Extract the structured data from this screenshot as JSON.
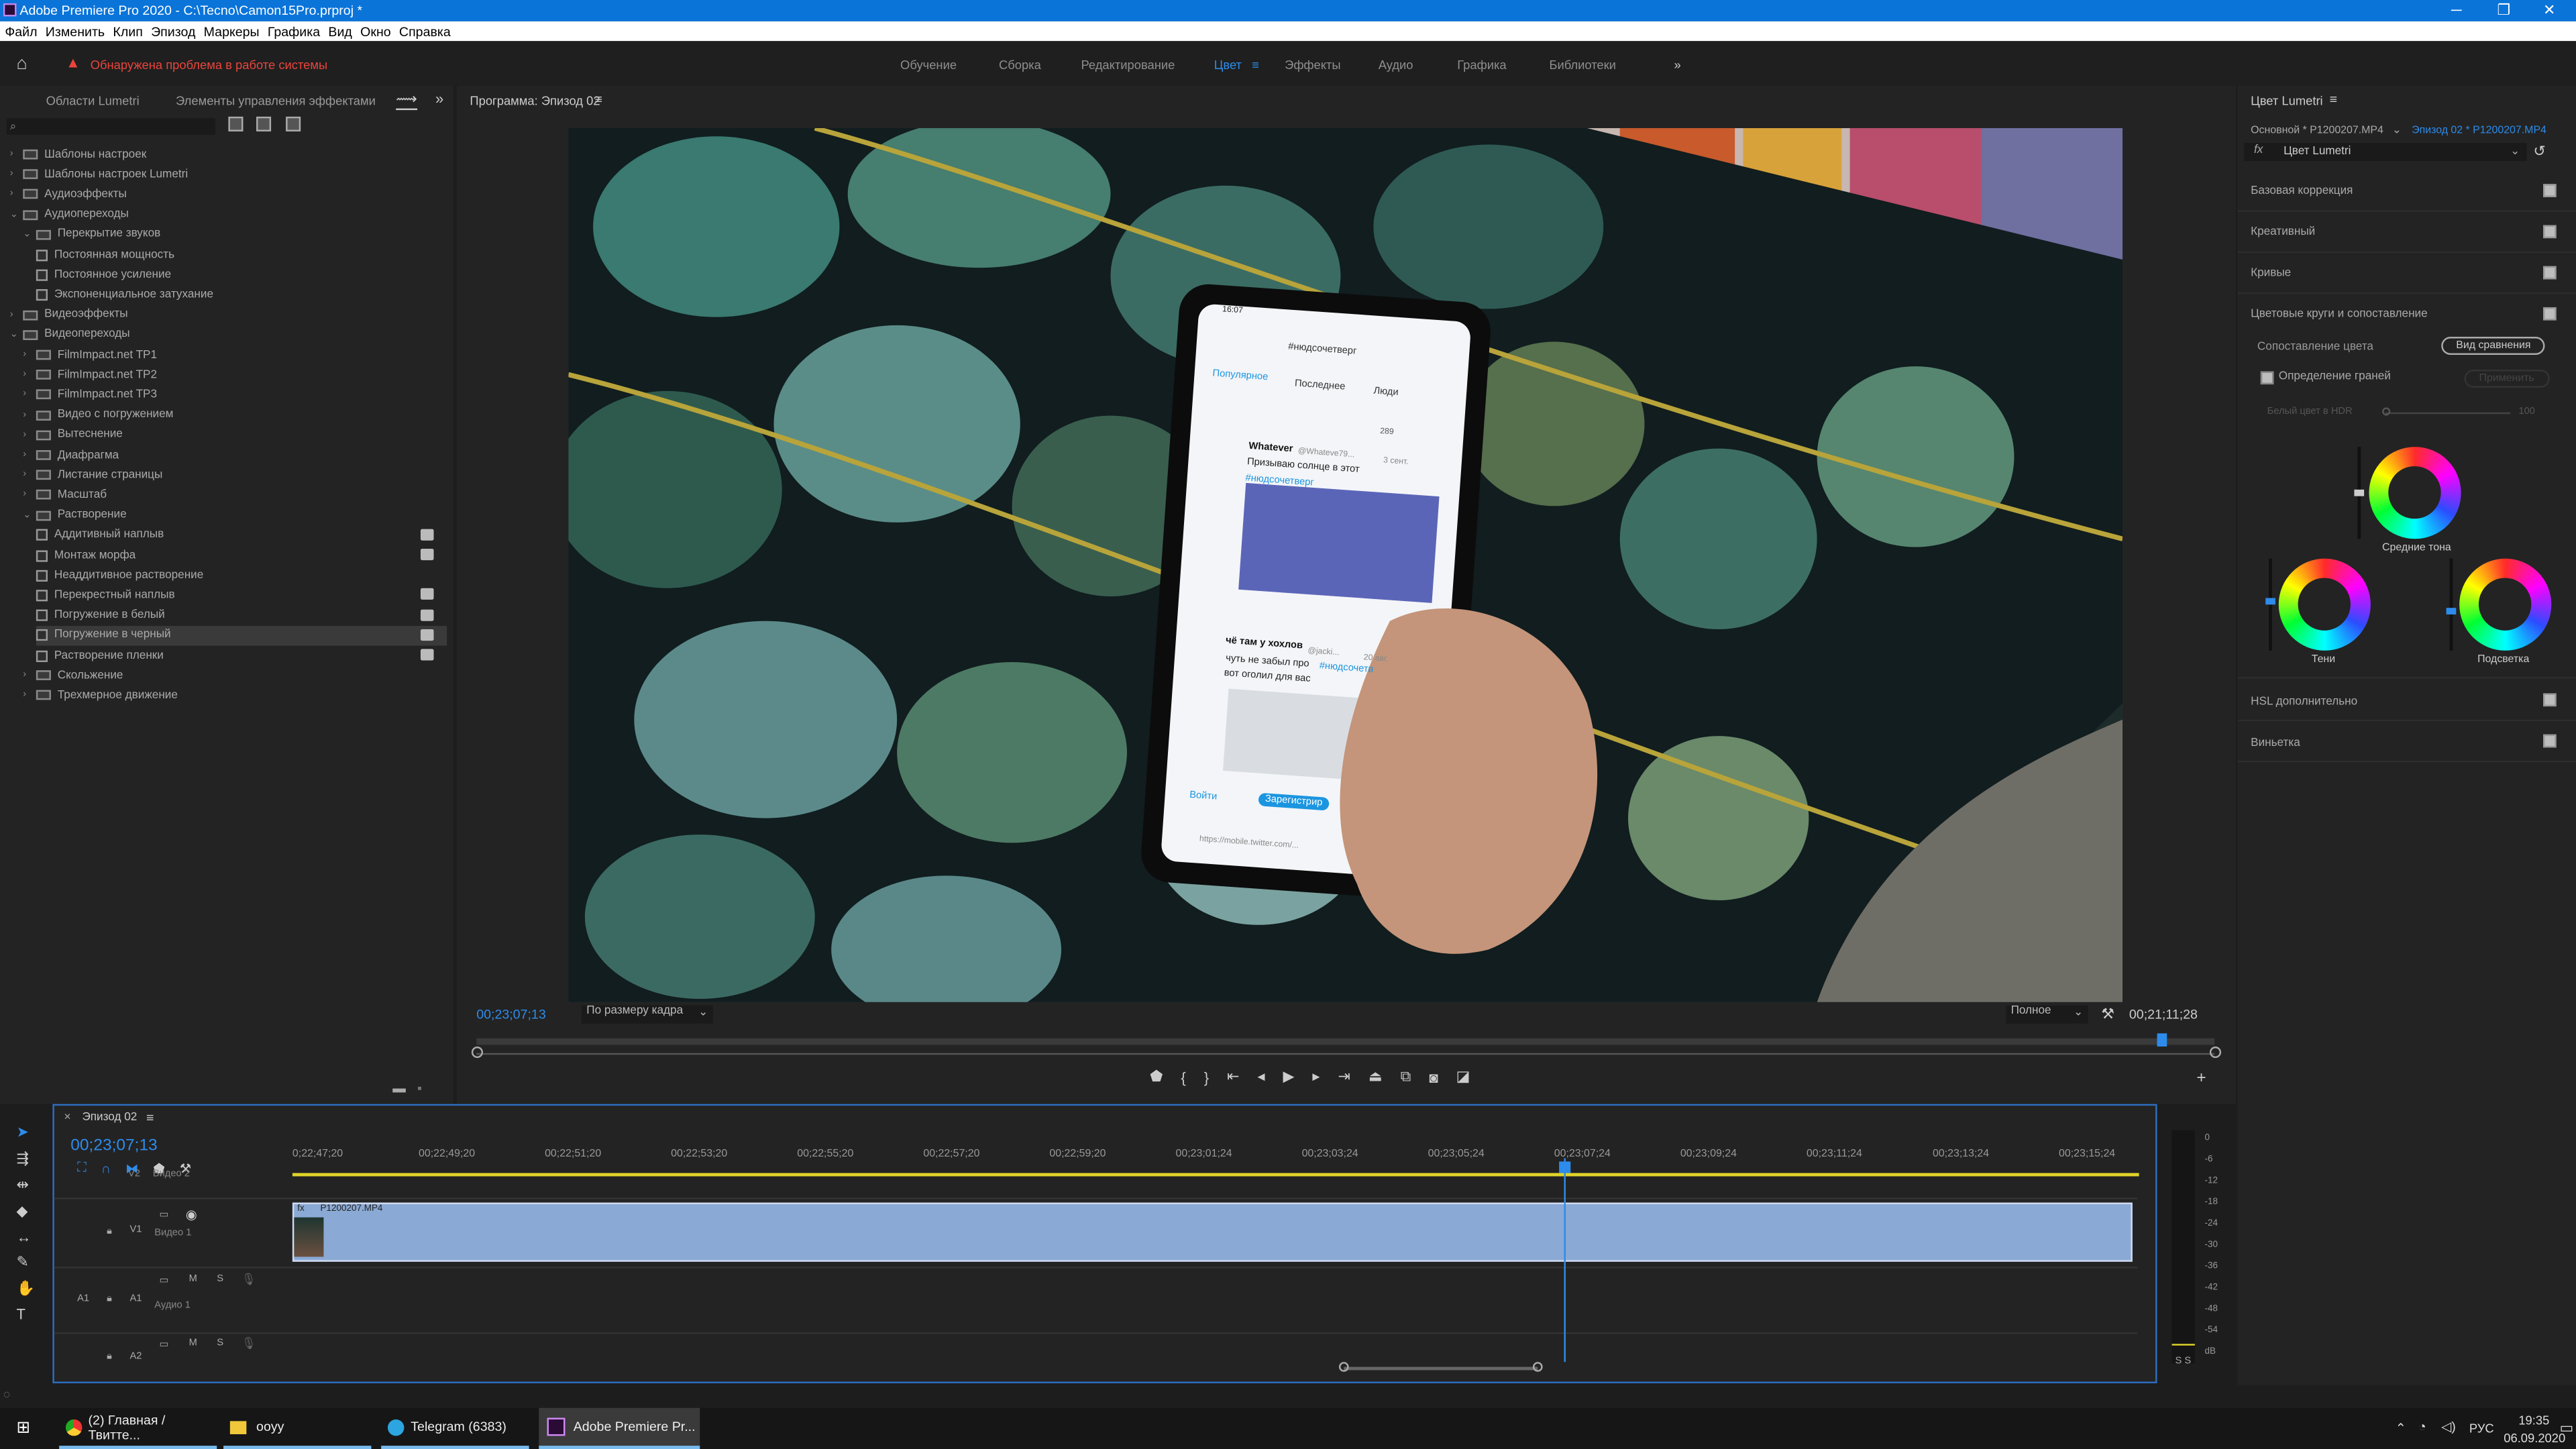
{
  "titlebar": {
    "title": "Adobe Premiere Pro 2020 - C:\\Tecno\\Camon15Pro.prproj *",
    "min": "─",
    "max": "❐",
    "close": "✕"
  },
  "menu": [
    "Файл",
    "Изменить",
    "Клип",
    "Эпизод",
    "Маркеры",
    "Графика",
    "Вид",
    "Окно",
    "Справка"
  ],
  "header": {
    "warning": "Обнаружена проблема в работе системы",
    "workspaces": [
      "Обучение",
      "Сборка",
      "Редактирование",
      "Цвет",
      "Эффекты",
      "Аудио",
      "Графика",
      "Библиотеки"
    ],
    "active_workspace": "Цвет",
    "more": "»"
  },
  "left_panel": {
    "tabs": [
      "Области Lumetri",
      "Элементы управления эффектами"
    ],
    "more": "»",
    "tree": [
      {
        "label": "Шаблоны настроек",
        "indent": 0,
        "kind": "folder",
        "open": false
      },
      {
        "label": "Шаблоны настроек Lumetri",
        "indent": 0,
        "kind": "folder",
        "open": false
      },
      {
        "label": "Аудиоэффекты",
        "indent": 0,
        "kind": "folder",
        "open": false
      },
      {
        "label": "Аудиопереходы",
        "indent": 0,
        "kind": "folder",
        "open": true
      },
      {
        "label": "Перекрытие звуков",
        "indent": 1,
        "kind": "folder",
        "open": true
      },
      {
        "label": "Постоянная мощность",
        "indent": 2,
        "kind": "fx"
      },
      {
        "label": "Постоянное усиление",
        "indent": 2,
        "kind": "fx"
      },
      {
        "label": "Экспоненциальное затухание",
        "indent": 2,
        "kind": "fx"
      },
      {
        "label": "Видеоэффекты",
        "indent": 0,
        "kind": "folder",
        "open": false
      },
      {
        "label": "Видеопереходы",
        "indent": 0,
        "kind": "folder",
        "open": true
      },
      {
        "label": "FilmImpact.net TP1",
        "indent": 1,
        "kind": "folder",
        "open": false
      },
      {
        "label": "FilmImpact.net TP2",
        "indent": 1,
        "kind": "folder",
        "open": false
      },
      {
        "label": "FilmImpact.net TP3",
        "indent": 1,
        "kind": "folder",
        "open": false
      },
      {
        "label": "Видео с погружением",
        "indent": 1,
        "kind": "folder",
        "open": false
      },
      {
        "label": "Вытеснение",
        "indent": 1,
        "kind": "folder",
        "open": false
      },
      {
        "label": "Диафрагма",
        "indent": 1,
        "kind": "folder",
        "open": false
      },
      {
        "label": "Листание страницы",
        "indent": 1,
        "kind": "folder",
        "open": false
      },
      {
        "label": "Масштаб",
        "indent": 1,
        "kind": "folder",
        "open": false
      },
      {
        "label": "Растворение",
        "indent": 1,
        "kind": "folder",
        "open": true
      },
      {
        "label": "Аддитивный наплыв",
        "indent": 2,
        "kind": "fx",
        "badge": true
      },
      {
        "label": "Монтаж морфа",
        "indent": 2,
        "kind": "fx",
        "badge": true
      },
      {
        "label": "Неаддитивное растворение",
        "indent": 2,
        "kind": "fx"
      },
      {
        "label": "Перекрестный наплыв",
        "indent": 2,
        "kind": "fx",
        "badge": true
      },
      {
        "label": "Погружение в белый",
        "indent": 2,
        "kind": "fx",
        "badge": true
      },
      {
        "label": "Погружение в черный",
        "indent": 2,
        "kind": "fx",
        "badge": true,
        "selected": true
      },
      {
        "label": "Растворение пленки",
        "indent": 2,
        "kind": "fx",
        "badge": true
      },
      {
        "label": "Скольжение",
        "indent": 1,
        "kind": "folder",
        "open": false
      },
      {
        "label": "Трехмерное движение",
        "indent": 1,
        "kind": "folder",
        "open": false
      }
    ]
  },
  "monitor": {
    "title": "Программа: Эпизод 02",
    "timecode": "00;23;07;13",
    "fit": "По размеру кадра",
    "quality": "Полное",
    "duration": "00;21;11;28"
  },
  "phone": {
    "time": "16:07",
    "search": "#нюдсочетверг",
    "tabs": [
      "Популярное",
      "Последнее",
      "Люди"
    ],
    "tweet1_name": "Whatever",
    "tweet1_handle": "@Whateve79...",
    "tweet1_date": "3 сент.",
    "tweet1_text": "Призываю солнце в этот",
    "tweet1_tag": "#нюдсочетверг",
    "likes": "289",
    "tweet2_name": "чё там у хохлов",
    "tweet2_handle": "@jacki...",
    "tweet2_date": "20 авг.",
    "tweet2_text": "чуть не забыл про",
    "tweet2_tag": "#нюдсочетв",
    "tweet2_text2": "вот оголил для вас",
    "login": "Войти",
    "register": "Зарегистрир",
    "url": "https://mobile.twitter.com/..."
  },
  "timeline": {
    "tab": "Эпизод 02",
    "timecode": "00;23;07;13",
    "ticks": [
      "0;22;47;20",
      "00;22;49;20",
      "00;22;51;20",
      "00;22;53;20",
      "00;22;55;20",
      "00;22;57;20",
      "00;22;59;20",
      "00;23;01;24",
      "00;23;03;24",
      "00;23;05;24",
      "00;23;07;24",
      "00;23;09;24",
      "00;23;11;24",
      "00;23;13;24",
      "00;23;15;24"
    ],
    "tracks": {
      "v2": "V2",
      "v2_name": "Видео 2",
      "v1": "V1",
      "v1_name": "Видео 1",
      "a1": "A1",
      "a1_name": "Аудио 1",
      "a2": "A2",
      "src_a1": "A1"
    },
    "clip": "P1200207.MP4",
    "meter_ticks": [
      "0",
      "-6",
      "-12",
      "-18",
      "-24",
      "-30",
      "-36",
      "-42",
      "-48",
      "-54",
      "dB"
    ],
    "meter_ss": "S S"
  },
  "lumetri": {
    "title": "Цвет Lumetri",
    "source": "Основной * P1200207.MP4",
    "target": "Эпизод 02 * P1200207.MP4",
    "effect": "Цвет Lumetri",
    "sections": [
      "Базовая коррекция",
      "Креативный",
      "Кривые",
      "Цветовые круги и сопоставление"
    ],
    "color_match": "Сопоставление цвета",
    "compare_view": "Вид сравнения",
    "face_detect": "Определение граней",
    "apply_match": "Применить",
    "hdr_white": "Белый цвет в HDR",
    "hdr_val": "100",
    "midtones": "Средние тона",
    "shadows": "Тени",
    "highlights": "Подсветка",
    "sections2": [
      "HSL дополнительно",
      "Виньетка"
    ]
  },
  "taskbar": {
    "items": [
      "(2) Главная / Твитте...",
      "ooyy",
      "Telegram (6383)",
      "Adobe Premiere Pr..."
    ],
    "lang": "РУС",
    "time": "19:35",
    "date": "06.09.2020"
  }
}
